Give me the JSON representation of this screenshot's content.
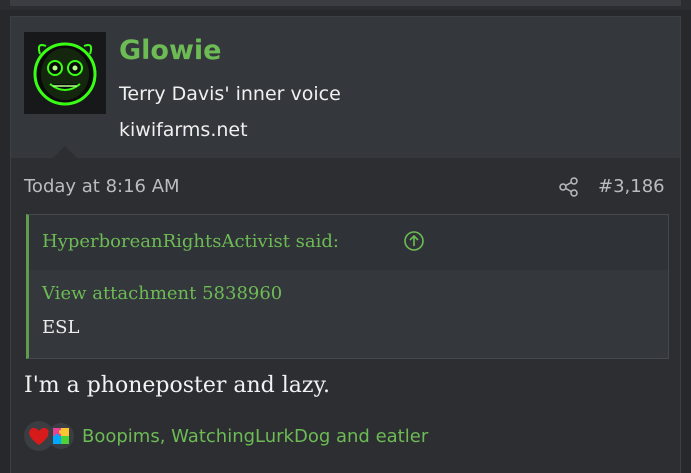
{
  "user": {
    "name": "Glowie",
    "title": "Terry Davis' inner voice",
    "banner": "kiwifarms.net"
  },
  "meta": {
    "time": "Today at 8:16 AM",
    "post_number": "#3,186"
  },
  "quote": {
    "author_line": "HyperboreanRightsActivist said:",
    "attachment": "View attachment 5838960",
    "text": "ESL"
  },
  "post": {
    "body": "I'm a phoneposter and lazy."
  },
  "reactions": {
    "names": "Boopims, WatchingLurkDog and eatler",
    "icons": [
      "heart-icon",
      "puzzle-icon"
    ]
  },
  "colors": {
    "accent_green": "#6dbb55",
    "background": "#26282b",
    "post_bg": "#2c2e32",
    "user_block_bg": "#34373c"
  }
}
